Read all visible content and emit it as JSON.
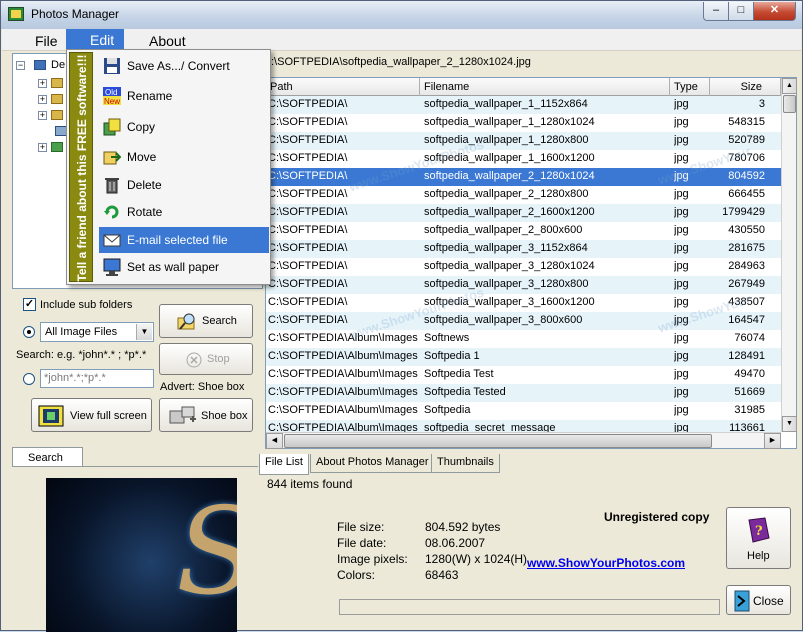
{
  "window": {
    "title": "Photos Manager",
    "min": "–",
    "max": "□",
    "close": "✕"
  },
  "menubar": {
    "file": "File",
    "edit": "Edit",
    "about": "About"
  },
  "edit_menu": {
    "banner": "Tell a friend about this FREE software!!!",
    "items": [
      {
        "label": "Save As.../ Convert",
        "icon": "floppy-icon"
      },
      {
        "label": "Rename",
        "icon": "old-new-icon"
      },
      {
        "label": "Copy",
        "icon": "copy-icon"
      },
      {
        "label": "Move",
        "icon": "move-icon"
      },
      {
        "label": "Delete",
        "icon": "trash-icon"
      },
      {
        "label": "Rotate",
        "icon": "rotate-icon"
      },
      {
        "label": "E-mail selected file",
        "icon": "email-icon"
      },
      {
        "label": "Set as wall paper",
        "icon": "monitor-icon"
      }
    ],
    "highlighted_index": 6
  },
  "tree": {
    "root_label": "De"
  },
  "search_panel": {
    "include_sub_folders": "Include sub folders",
    "include_checked": true,
    "filter_value": "All Image Files",
    "search_hint": "Search: e.g. *john*.*  ;  *p*.*",
    "pattern_placeholder": "*john*.*;*p*.*",
    "search_button": "Search",
    "stop_button": "Stop",
    "advert": "Advert: Shoe box",
    "view_full_screen": "View  full screen",
    "shoe_box": "Shoe box",
    "tab": "Search"
  },
  "current_path": ":\\SOFTPEDIA\\softpedia_wallpaper_2_1280x1024.jpg",
  "table": {
    "columns": [
      "Path",
      "Filename",
      "Type",
      "Size"
    ],
    "selected_index": 4,
    "rows": [
      [
        "C:\\SOFTPEDIA\\",
        "softpedia_wallpaper_1_1152x864",
        "jpg",
        "3"
      ],
      [
        "C:\\SOFTPEDIA\\",
        "softpedia_wallpaper_1_1280x1024",
        "jpg",
        "548315"
      ],
      [
        "C:\\SOFTPEDIA\\",
        "softpedia_wallpaper_1_1280x800",
        "jpg",
        "520789"
      ],
      [
        "C:\\SOFTPEDIA\\",
        "softpedia_wallpaper_1_1600x1200",
        "jpg",
        "780706"
      ],
      [
        "C:\\SOFTPEDIA\\",
        "softpedia_wallpaper_2_1280x1024",
        "jpg",
        "804592"
      ],
      [
        "C:\\SOFTPEDIA\\",
        "softpedia_wallpaper_2_1280x800",
        "jpg",
        "666455"
      ],
      [
        "C:\\SOFTPEDIA\\",
        "softpedia_wallpaper_2_1600x1200",
        "jpg",
        "1799429"
      ],
      [
        "C:\\SOFTPEDIA\\",
        "softpedia_wallpaper_2_800x600",
        "jpg",
        "430550"
      ],
      [
        "C:\\SOFTPEDIA\\",
        "softpedia_wallpaper_3_1152x864",
        "jpg",
        "281675"
      ],
      [
        "C:\\SOFTPEDIA\\",
        "softpedia_wallpaper_3_1280x1024",
        "jpg",
        "284963"
      ],
      [
        "C:\\SOFTPEDIA\\",
        "softpedia_wallpaper_3_1280x800",
        "jpg",
        "267949"
      ],
      [
        "C:\\SOFTPEDIA\\",
        "softpedia_wallpaper_3_1600x1200",
        "jpg",
        "438507"
      ],
      [
        "C:\\SOFTPEDIA\\",
        "softpedia_wallpaper_3_800x600",
        "jpg",
        "164547"
      ],
      [
        "C:\\SOFTPEDIA\\Album\\Images ...",
        "Softnews",
        "jpg",
        "76074"
      ],
      [
        "C:\\SOFTPEDIA\\Album\\Images ...",
        "Softpedia 1",
        "jpg",
        "128491"
      ],
      [
        "C:\\SOFTPEDIA\\Album\\Images ...",
        "Softpedia Test",
        "jpg",
        "49470"
      ],
      [
        "C:\\SOFTPEDIA\\Album\\Images ...",
        "Softpedia Tested",
        "jpg",
        "51669"
      ],
      [
        "C:\\SOFTPEDIA\\Album\\Images ...",
        "Softpedia",
        "jpg",
        "31985"
      ],
      [
        "C:\\SOFTPEDIA\\Album\\Images ...",
        "softpedia_secret_message",
        "jpg",
        "113661"
      ]
    ]
  },
  "bottom_tabs": [
    "File List",
    "About Photos Manager",
    "Thumbnails"
  ],
  "status": {
    "items_found": "844 items found"
  },
  "file_info": {
    "labels": [
      "File size:",
      "File date:",
      "Image pixels:",
      "Colors:"
    ],
    "values": [
      "804.592 bytes",
      "08.06.2007",
      "1280(W) x 1024(H)",
      "68463"
    ]
  },
  "unregistered": "Unregistered copy",
  "website": "www.ShowYourPhotos.com",
  "help_button": "Help",
  "close_button": "Close",
  "preview_letter": "S",
  "colors": {
    "accent": "#3a78d4",
    "row_alt": "#e6f4fa",
    "banner": "#8a8a10"
  }
}
